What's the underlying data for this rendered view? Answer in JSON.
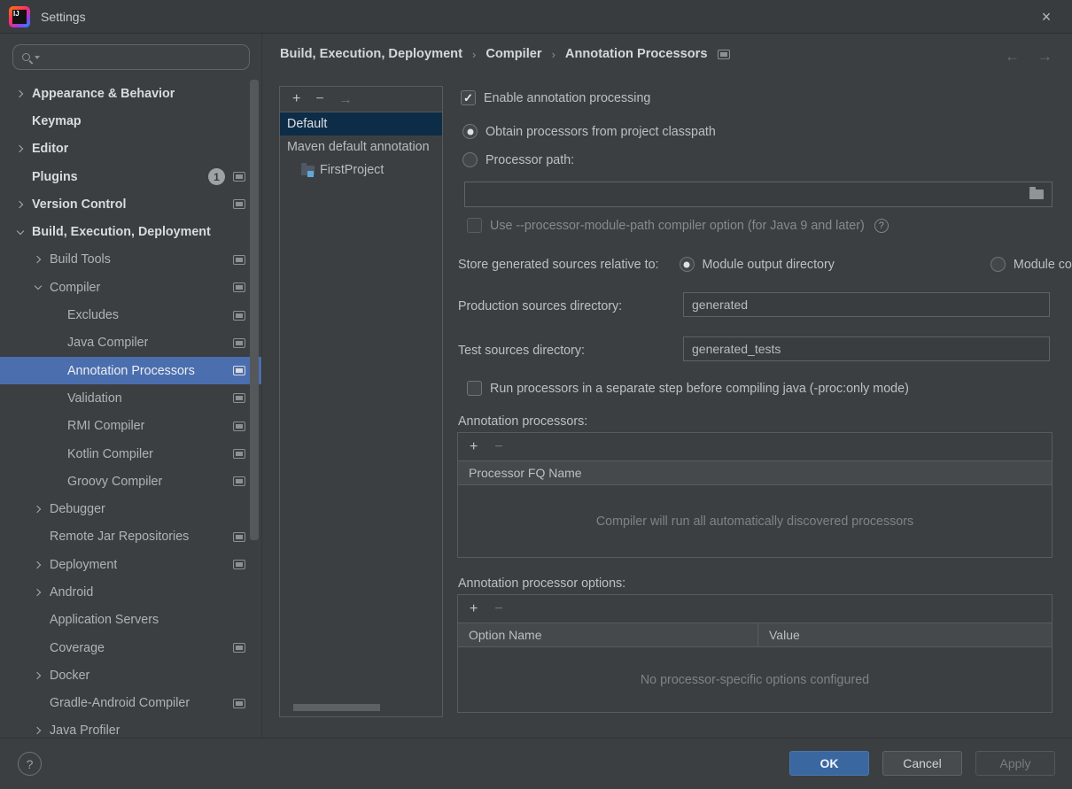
{
  "colors": {
    "accent-blue": "#4b6eaf",
    "list-selection": "#0d2c47",
    "primary-button": "#3b67a0",
    "badge-bg": "#9da2a4"
  },
  "window": {
    "title": "Settings",
    "logo_text": "IJ",
    "close_icon": "×"
  },
  "nav": {
    "back": "←",
    "forward": "→"
  },
  "glyphs": {
    "check": "✓",
    "question": "?"
  },
  "sidebar": {
    "items": [
      {
        "label": "Appearance & Behavior",
        "level": 0,
        "chevron": "right",
        "bold": true
      },
      {
        "label": "Keymap",
        "level": 0,
        "bold": true
      },
      {
        "label": "Editor",
        "level": 0,
        "chevron": "right",
        "bold": true
      },
      {
        "label": "Plugins",
        "level": 0,
        "bold": true,
        "badge": "1",
        "icon": true
      },
      {
        "label": "Version Control",
        "level": 0,
        "chevron": "right",
        "bold": true,
        "icon": true
      },
      {
        "label": "Build, Execution, Deployment",
        "level": 0,
        "chevron": "down",
        "bold": true
      },
      {
        "label": "Build Tools",
        "level": 1,
        "chevron": "right",
        "icon": true
      },
      {
        "label": "Compiler",
        "level": 1,
        "chevron": "down",
        "icon": true
      },
      {
        "label": "Excludes",
        "level": 2,
        "icon": true
      },
      {
        "label": "Java Compiler",
        "level": 2,
        "icon": true
      },
      {
        "label": "Annotation Processors",
        "level": 2,
        "icon": true,
        "selected": true
      },
      {
        "label": "Validation",
        "level": 2,
        "icon": true
      },
      {
        "label": "RMI Compiler",
        "level": 2,
        "icon": true
      },
      {
        "label": "Kotlin Compiler",
        "level": 2,
        "icon": true
      },
      {
        "label": "Groovy Compiler",
        "level": 2,
        "icon": true
      },
      {
        "label": "Debugger",
        "level": 1,
        "chevron": "right"
      },
      {
        "label": "Remote Jar Repositories",
        "level": 1,
        "icon": true
      },
      {
        "label": "Deployment",
        "level": 1,
        "chevron": "right",
        "icon": true
      },
      {
        "label": "Android",
        "level": 1,
        "chevron": "right"
      },
      {
        "label": "Application Servers",
        "level": 1
      },
      {
        "label": "Coverage",
        "level": 1,
        "icon": true
      },
      {
        "label": "Docker",
        "level": 1,
        "chevron": "right"
      },
      {
        "label": "Gradle-Android Compiler",
        "level": 1,
        "icon": true
      },
      {
        "label": "Java Profiler",
        "level": 1,
        "chevron": "right"
      }
    ]
  },
  "breadcrumb": {
    "items": [
      "Build, Execution, Deployment",
      "Compiler",
      "Annotation Processors"
    ],
    "separator": "›"
  },
  "profiles": {
    "toolbar": {
      "add": "+",
      "remove": "−",
      "move": "→"
    },
    "items": [
      {
        "label": "Default",
        "selected": true,
        "indent": 0
      },
      {
        "label": "Maven default annotation",
        "indent": 0
      },
      {
        "label": "FirstProject",
        "indent": 1,
        "icon": "module-folder"
      }
    ]
  },
  "main": {
    "enable_checkbox": {
      "label": "Enable annotation processing",
      "checked": true
    },
    "obtain_radio": {
      "label": "Obtain processors from project classpath",
      "selected": true
    },
    "processor_path_radio": {
      "label": "Processor path:",
      "selected": false
    },
    "processor_path_field": {
      "value": ""
    },
    "module_path_checkbox": {
      "label": "Use --processor-module-path compiler option (for Java 9 and later)",
      "checked": false,
      "disabled": true
    },
    "store_group": {
      "label": "Store generated sources relative to:",
      "options": [
        {
          "label": "Module output directory",
          "selected": true
        },
        {
          "label": "Module content root",
          "selected": false
        }
      ]
    },
    "production_row": {
      "label": "Production sources directory:",
      "value": "generated"
    },
    "test_row": {
      "label": "Test sources directory:",
      "value": "generated_tests"
    },
    "run_separate_checkbox": {
      "label": "Run processors in a separate step before compiling java (-proc:only mode)",
      "checked": false
    },
    "processors_section": {
      "label": "Annotation processors:",
      "toolbar": {
        "add": "+",
        "remove": "−"
      },
      "header": "Processor FQ Name",
      "empty_text": "Compiler will run all automatically discovered processors"
    },
    "options_section": {
      "label": "Annotation processor options:",
      "toolbar": {
        "add": "+",
        "remove": "−"
      },
      "headers": [
        "Option Name",
        "Value"
      ],
      "empty_text": "No processor-specific options configured"
    }
  },
  "footer": {
    "help": "?",
    "ok": "OK",
    "cancel": "Cancel",
    "apply": "Apply"
  }
}
